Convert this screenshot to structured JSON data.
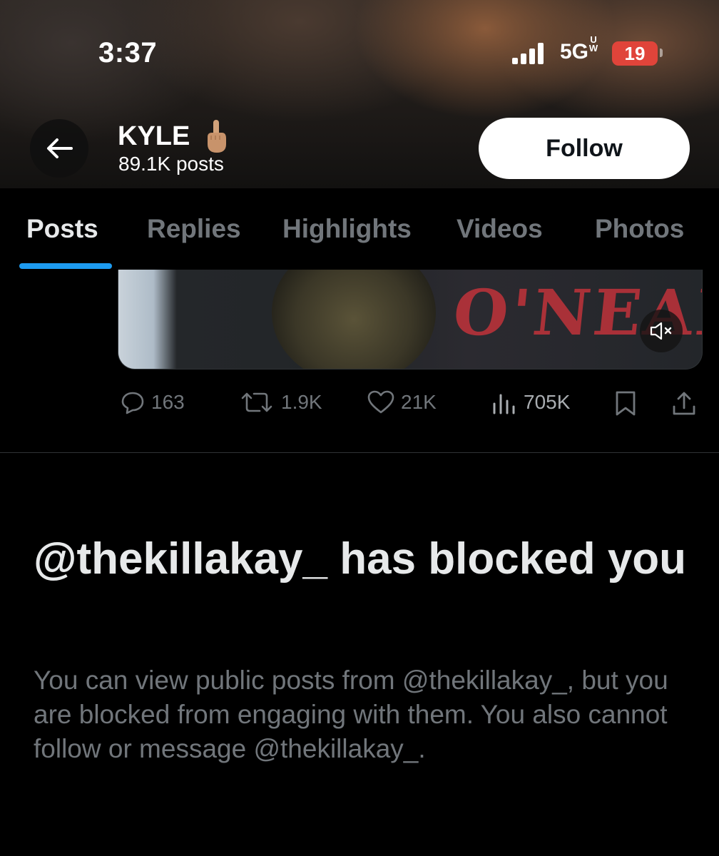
{
  "status_bar": {
    "time": "3:37",
    "network": "5G",
    "network_sub": "UW",
    "battery": "19"
  },
  "profile": {
    "name": "KYLE",
    "posts_count": "89.1K posts",
    "follow_label": "Follow"
  },
  "tabs": [
    {
      "label": "Posts",
      "active": true
    },
    {
      "label": "Replies",
      "active": false
    },
    {
      "label": "Highlights",
      "active": false
    },
    {
      "label": "Videos",
      "active": false
    },
    {
      "label": "Photos",
      "active": false
    }
  ],
  "media": {
    "shirt_text": "O'NEAL"
  },
  "post_actions": {
    "replies": "163",
    "reposts": "1.9K",
    "likes": "21K",
    "views": "705K"
  },
  "blocked": {
    "title": "@thekillakay_ has blocked you",
    "description": "You can view public posts from @thekillakay_, but you are blocked from engaging with them. You also cannot follow or message @thekillakay_."
  },
  "colors": {
    "accent": "#1d9bf0",
    "background": "#000000",
    "muted_text": "#71767b",
    "battery_low": "#e0443a"
  }
}
